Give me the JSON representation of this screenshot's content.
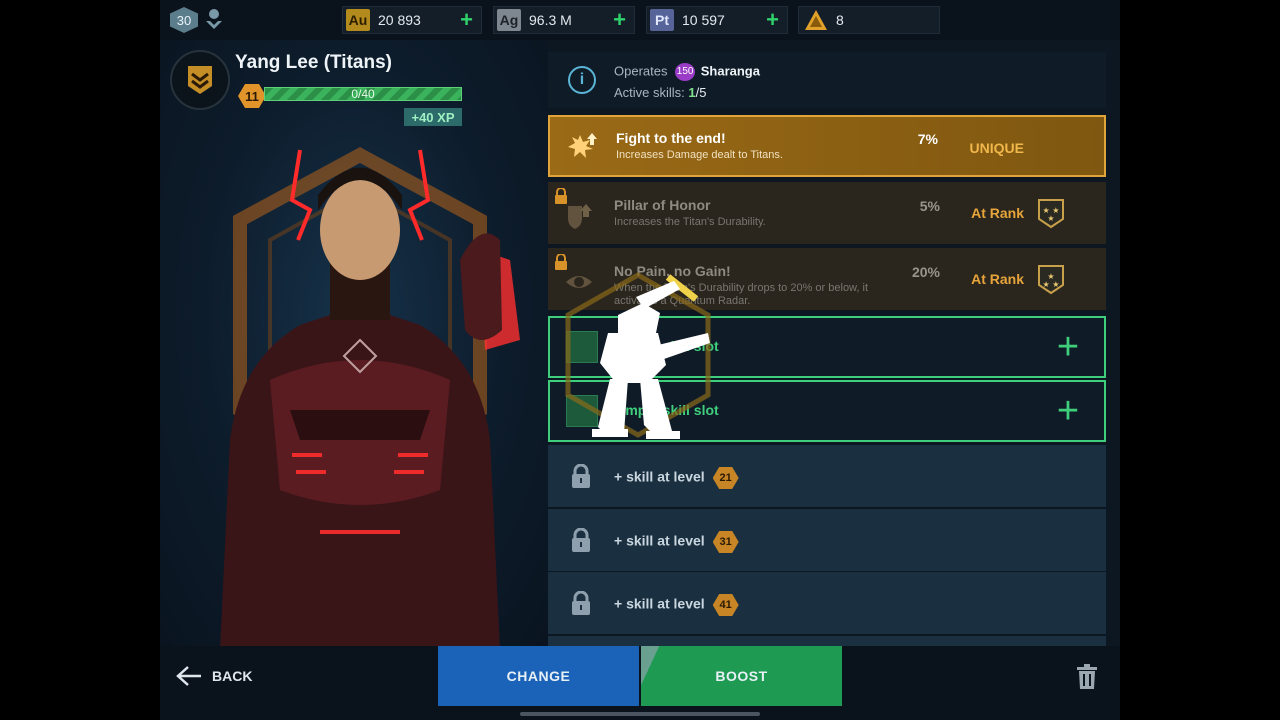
{
  "player": {
    "level": "30"
  },
  "currencies": [
    {
      "code": "Au",
      "value": "20 893",
      "has_add": true,
      "color": "#d8a826"
    },
    {
      "code": "Ag",
      "value": "96.3 M",
      "has_add": true,
      "color": "#9aa3ac"
    },
    {
      "code": "Pt",
      "value": "10 597",
      "has_add": true,
      "color": "#6f7fb6"
    },
    {
      "code": "",
      "value": "8",
      "has_add": false,
      "color": "#e0a02a"
    }
  ],
  "pilot": {
    "name": "Yang Lee (Titans)",
    "level": "11",
    "xp_progress": "0/40",
    "xp_bonus": "+40 XP"
  },
  "info": {
    "operates_label": "Operates",
    "robot_level": "150",
    "robot_name": "Sharanga",
    "active_label": "Active skills:",
    "active_current": "1",
    "active_total": "/5"
  },
  "skills": [
    {
      "title": "Fight to the end!",
      "desc": "Increases Damage dealt to Titans.",
      "percent": "7%",
      "tag": "UNIQUE"
    },
    {
      "title": "Pillar of Honor",
      "desc": "Increases the Titan's Durability.",
      "percent": "5%",
      "tag": "At Rank"
    },
    {
      "title": "No Pain, no Gain!",
      "desc": "When the Titan's Durability drops to 20% or below, it activates a Quantum Radar.",
      "percent": "20%",
      "tag": "At Rank"
    }
  ],
  "empty_slots": [
    {
      "label": "Empty skill slot"
    },
    {
      "label": "Empty skill slot"
    }
  ],
  "future_slots": [
    {
      "label": "+ skill at level",
      "level": "21"
    },
    {
      "label": "+ skill at level",
      "level": "31"
    },
    {
      "label": "+ skill at level",
      "level": "41"
    }
  ],
  "bottom": {
    "back": "BACK",
    "change": "CHANGE",
    "boost": "BOOST"
  },
  "colors": {
    "accent_green": "#3fcf7c",
    "unique_gold": "#e0a43a",
    "change_blue": "#1a63b8",
    "boost_green": "#1e9a52"
  }
}
